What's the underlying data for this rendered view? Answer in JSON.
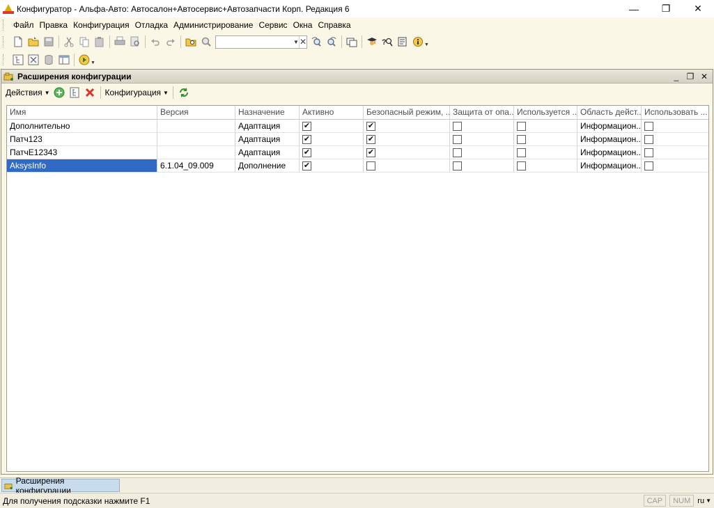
{
  "window": {
    "title": "Конфигуратор - Альфа-Авто: Автосалон+Автосервис+Автозапчасти Корп. Редакция 6",
    "minimize_glyph": "—",
    "maximize_glyph": "❐",
    "close_glyph": "✕"
  },
  "menu": [
    "Файл",
    "Правка",
    "Конфигурация",
    "Отладка",
    "Администрирование",
    "Сервис",
    "Окна",
    "Справка"
  ],
  "search": {
    "value": "",
    "clear_glyph": "✕",
    "drop_glyph": "▼"
  },
  "document": {
    "title": "Расширения конфигурации",
    "actions_label": "Действия",
    "configuration_label": "Конфигурация",
    "grid": {
      "headers": [
        "Имя",
        "Версия",
        "Назначение",
        "Активно",
        "Безопасный режим, ...",
        "Защита от опа...",
        "Используется ...",
        "Область дейст...",
        "Использовать ..."
      ],
      "rows": [
        {
          "name": "Дополнительно",
          "version": "",
          "purpose": "Адаптация",
          "active": true,
          "safe_mode": true,
          "protection": false,
          "used": false,
          "area": "Информацион...",
          "use": false
        },
        {
          "name": "Патч123",
          "version": "",
          "purpose": "Адаптация",
          "active": true,
          "safe_mode": true,
          "protection": false,
          "used": false,
          "area": "Информацион...",
          "use": false
        },
        {
          "name": "ПатчE12343",
          "version": "",
          "purpose": "Адаптация",
          "active": true,
          "safe_mode": true,
          "protection": false,
          "used": false,
          "area": "Информацион...",
          "use": false
        },
        {
          "name": "AksysInfo",
          "version": "6.1.04_09.009",
          "purpose": "Дополнение",
          "active": true,
          "safe_mode": false,
          "protection": false,
          "used": false,
          "area": "Информацион...",
          "use": false
        }
      ],
      "selected_row": 3
    }
  },
  "taskbar": {
    "tab_label": "Расширения конфигурации"
  },
  "status": {
    "hint": "Для получения подсказки нажмите F1",
    "cap": "CAP",
    "num": "NUM",
    "lang": "ru"
  },
  "colors": {
    "selection": "#316ac5",
    "background": "#fbf7e6",
    "window_border": "#8e8e8e"
  }
}
